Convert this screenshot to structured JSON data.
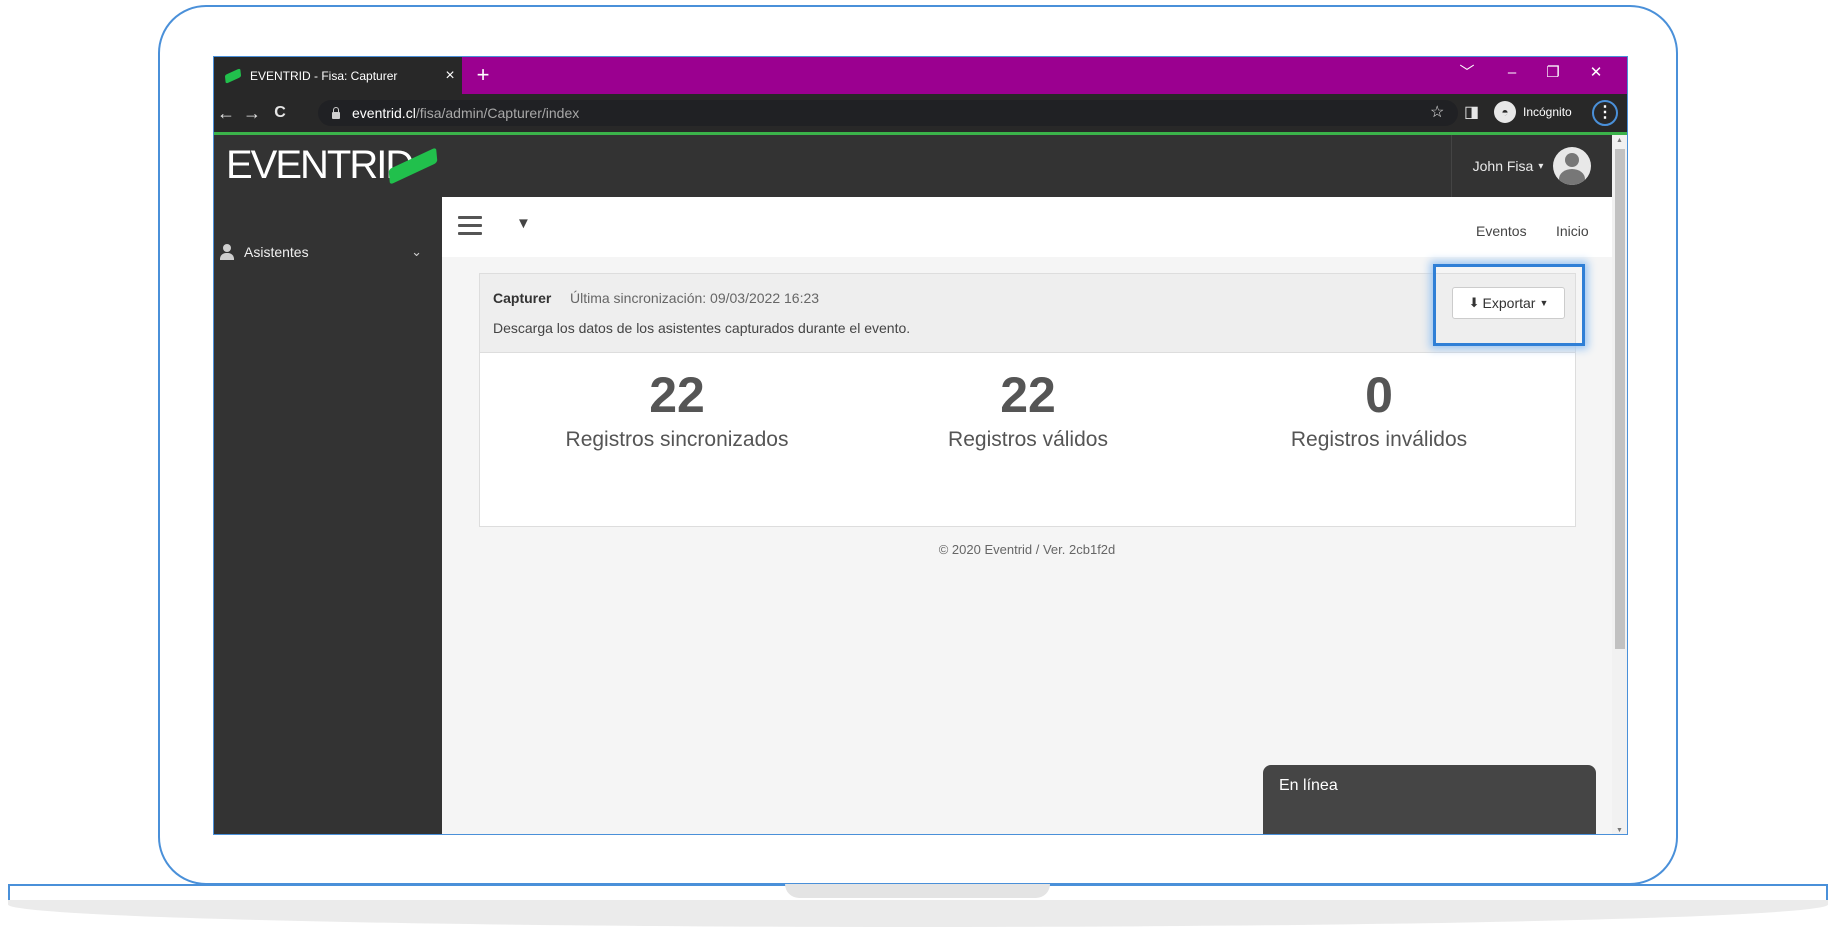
{
  "browser": {
    "tab_title": "EVENTRID - Fisa: Capturer",
    "tab_close": "×",
    "new_tab": "+",
    "url_host": "eventrid.cl",
    "url_path": "/fisa/admin/Capturer/index",
    "incognito_label": "Incógnito",
    "win_controls": [
      "﹀",
      "–",
      "❐",
      "✕"
    ],
    "nav": {
      "back": "←",
      "forward": "→",
      "reload": "C"
    },
    "star": "☆",
    "side_panel": "◨",
    "menu": "⋮"
  },
  "app": {
    "logo": "EVENTRID",
    "user_name": "John Fisa",
    "user_caret": "▾"
  },
  "sidebar": {
    "items": [
      {
        "label": "Asistentes",
        "icon": "person-icon"
      }
    ],
    "chevron": "⌄"
  },
  "header": {
    "caret": "▼",
    "links": [
      "Eventos",
      "Inicio"
    ]
  },
  "panel": {
    "title": "Capturer",
    "sync_text": "Última sincronización: 09/03/2022 16:23",
    "description": "Descarga los datos de los asistentes capturados durante el evento.",
    "export_label": "Exportar",
    "export_icon": "download-icon"
  },
  "stats": [
    {
      "value": "22",
      "label": "Registros sincronizados"
    },
    {
      "value": "22",
      "label": "Registros válidos"
    },
    {
      "value": "0",
      "label": "Registros inválidos"
    }
  ],
  "footer": "© 2020 Eventrid / Ver. 2cb1f2d",
  "chat": {
    "status": "En línea"
  },
  "colors": {
    "tabstrip": "#9b0090",
    "nav_dark": "#333333",
    "accent_green": "#21c04c",
    "highlight_blue": "#2f7fd6"
  }
}
